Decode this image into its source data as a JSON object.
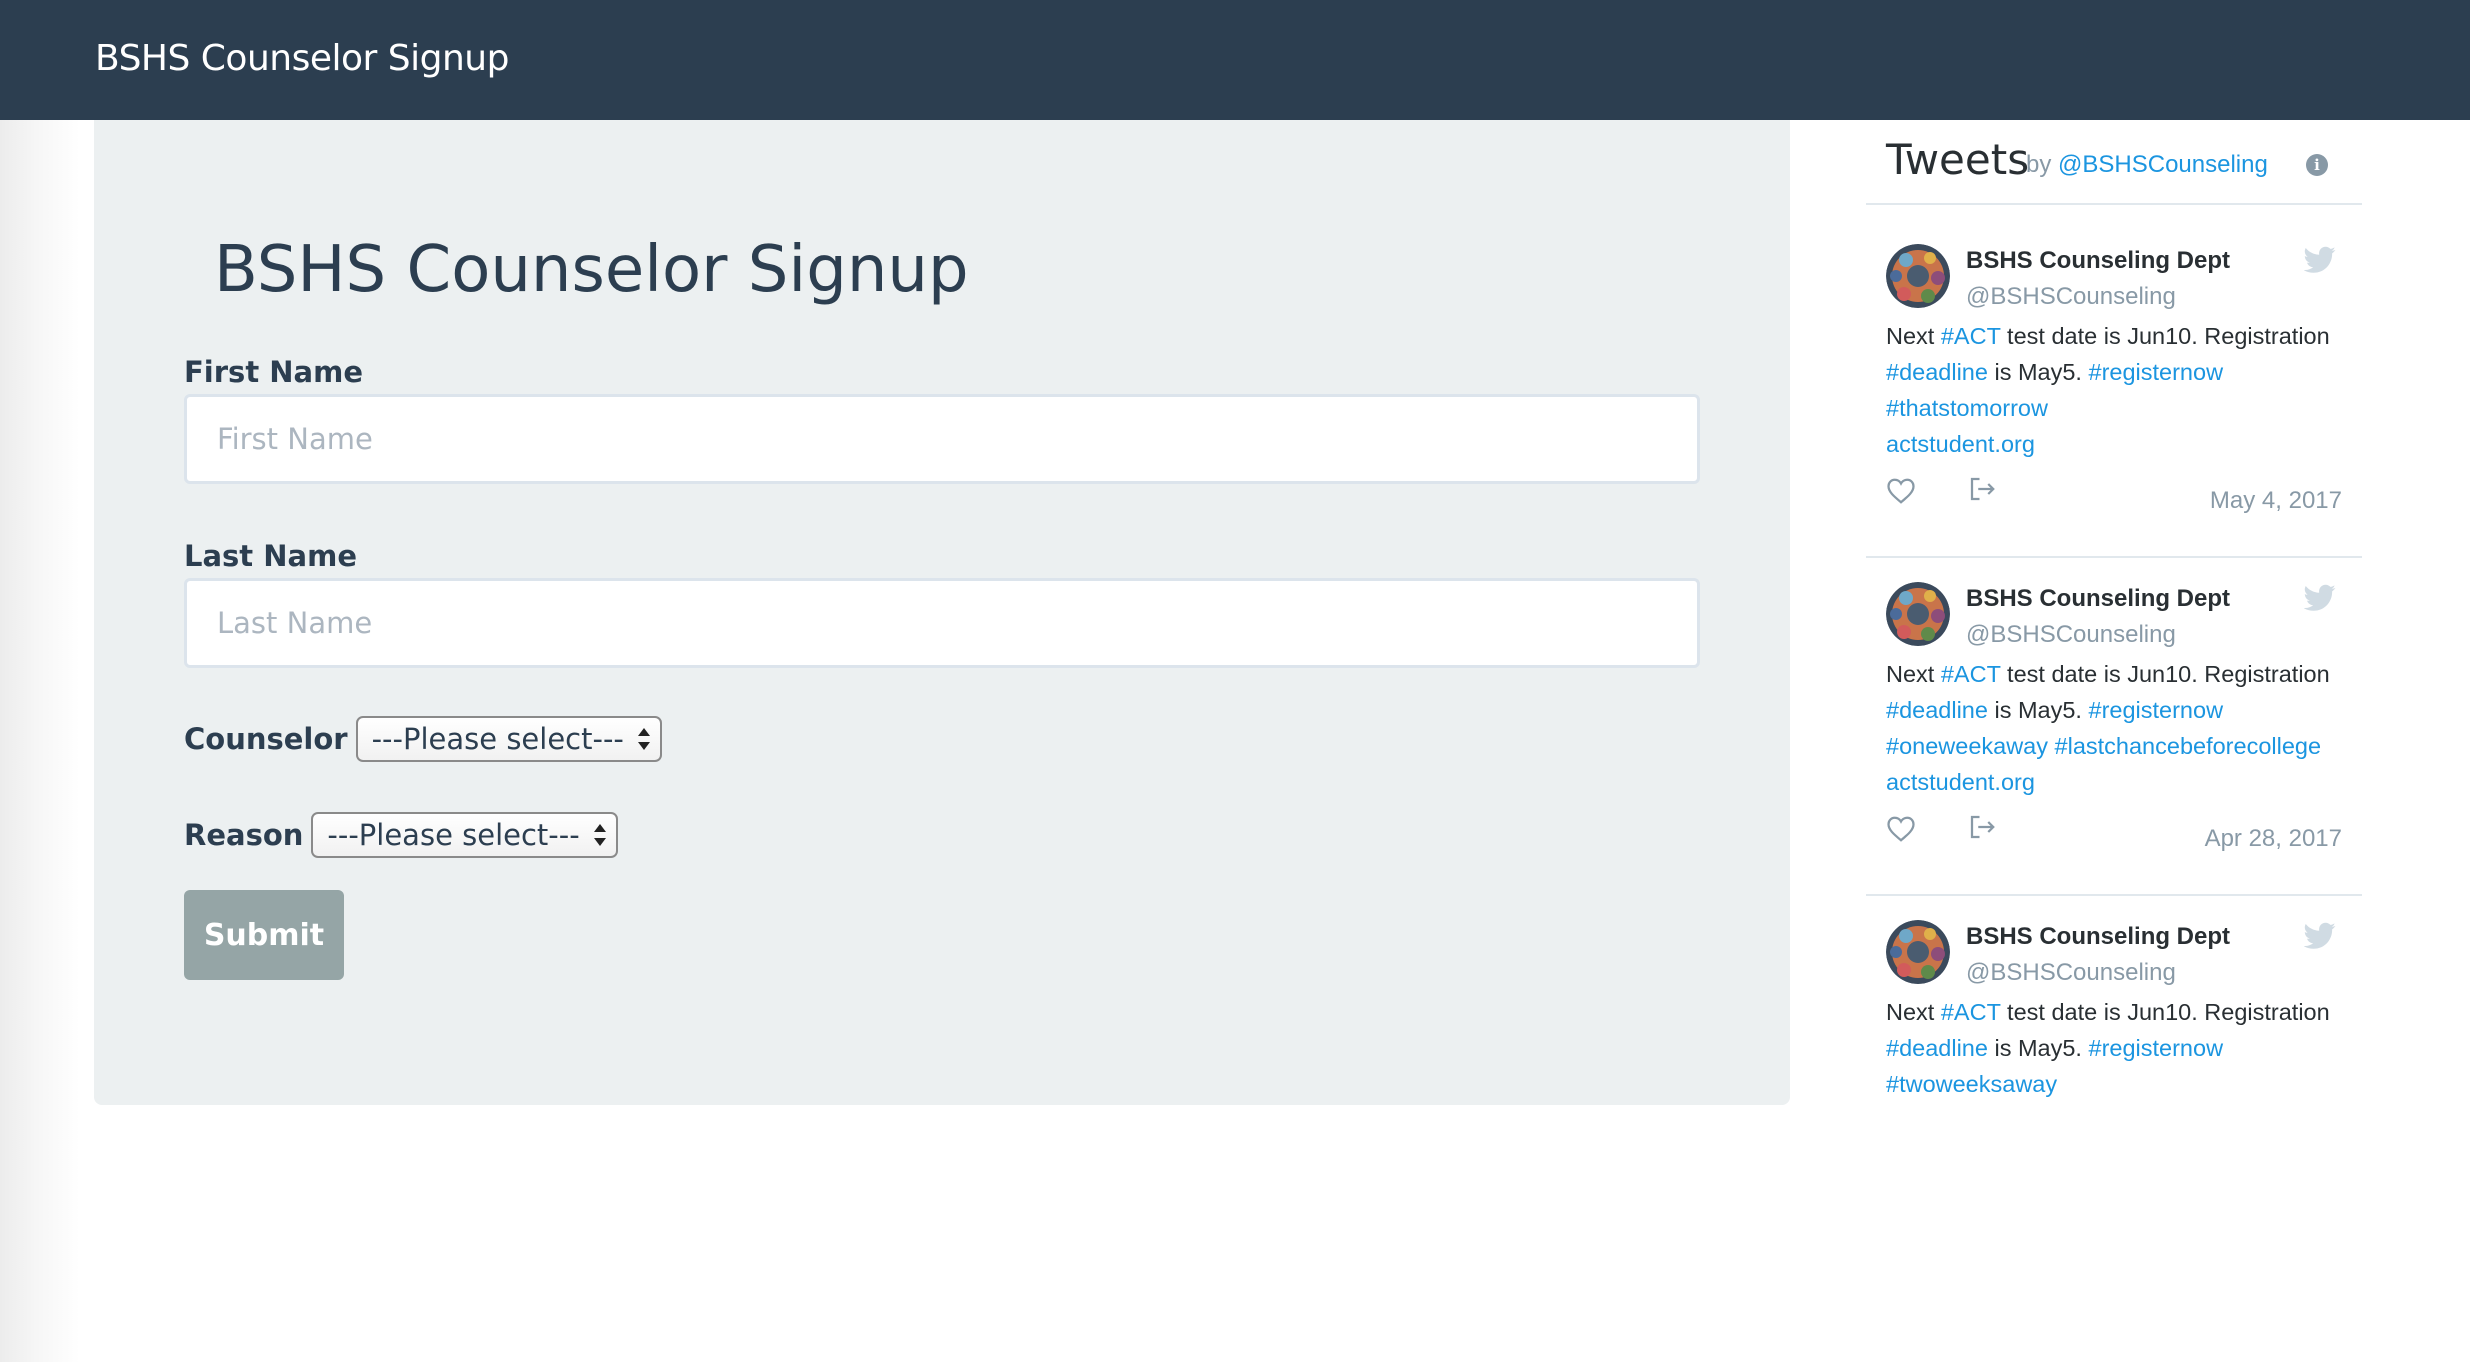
{
  "navbar": {
    "brand": "BSHS Counselor Signup"
  },
  "form": {
    "title": "BSHS Counselor Signup",
    "first_name": {
      "label": "First Name",
      "placeholder": "First Name",
      "value": ""
    },
    "last_name": {
      "label": "Last Name",
      "placeholder": "Last Name",
      "value": ""
    },
    "counselor": {
      "label": "Counselor",
      "selected": "---Please select---"
    },
    "reason": {
      "label": "Reason",
      "selected": "---Please select---"
    },
    "submit_label": "Submit"
  },
  "twitter": {
    "header": "Tweets",
    "by": "by",
    "account": "@BSHSCounseling",
    "info_icon": "i",
    "tweets": [
      {
        "name": "BSHS Counseling Dept",
        "handle": "@BSHSCounseling",
        "lines": [
          [
            {
              "t": "Next "
            },
            {
              "t": "#ACT",
              "h": true
            },
            {
              "t": " test date is Jun10. Registration"
            }
          ],
          [
            {
              "t": "#deadline",
              "h": true
            },
            {
              "t": " is May5. "
            },
            {
              "t": "#registernow",
              "h": true
            }
          ],
          [
            {
              "t": "#thatstomorrow",
              "h": true
            }
          ],
          [
            {
              "t": "actstudent.org",
              "h": true
            }
          ]
        ],
        "date": "May 4, 2017"
      },
      {
        "name": "BSHS Counseling Dept",
        "handle": "@BSHSCounseling",
        "lines": [
          [
            {
              "t": "Next "
            },
            {
              "t": "#ACT",
              "h": true
            },
            {
              "t": " test date is Jun10. Registration"
            }
          ],
          [
            {
              "t": "#deadline",
              "h": true
            },
            {
              "t": " is May5. "
            },
            {
              "t": "#registernow",
              "h": true
            }
          ],
          [
            {
              "t": "#oneweekaway",
              "h": true
            },
            {
              "t": " "
            },
            {
              "t": "#lastchancebeforecollege",
              "h": true
            }
          ],
          [
            {
              "t": "actstudent.org",
              "h": true
            }
          ]
        ],
        "date": "Apr 28, 2017"
      },
      {
        "name": "BSHS Counseling Dept",
        "handle": "@BSHSCounseling",
        "lines": [
          [
            {
              "t": "Next "
            },
            {
              "t": "#ACT",
              "h": true
            },
            {
              "t": " test date is Jun10. Registration"
            }
          ],
          [
            {
              "t": "#deadline",
              "h": true
            },
            {
              "t": " is May5. "
            },
            {
              "t": "#registernow",
              "h": true
            }
          ],
          [
            {
              "t": "#twoweeksaway",
              "h": true
            }
          ]
        ],
        "date": ""
      }
    ]
  },
  "icons": [
    "avatar",
    "twitter-bird-icon",
    "heart-icon",
    "share-icon",
    "info-icon",
    "select-arrows-icon"
  ],
  "colors": {
    "navbar": "#2c3e50",
    "card": "#ecf0f1",
    "submit": "#95a5a6",
    "link": "#1b95e0",
    "muted": "#8899a6"
  }
}
